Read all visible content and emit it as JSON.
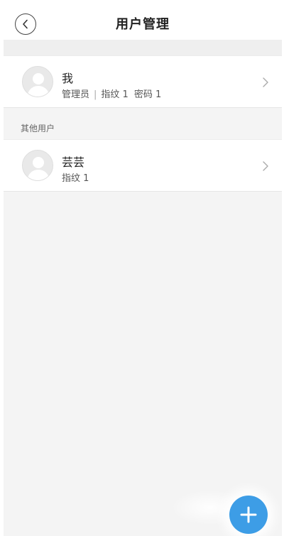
{
  "header": {
    "title": "用户管理",
    "back_icon": "chevron-left-icon"
  },
  "current_user": {
    "name": "我",
    "role": "管理员",
    "fingerprint": "指纹 1",
    "password": "密码 1"
  },
  "other_users": {
    "section_label": "其他用户",
    "items": [
      {
        "name": "芸芸",
        "fingerprint": "指纹 1"
      }
    ]
  },
  "fab": {
    "icon": "plus-icon",
    "color": "#3d9de6"
  },
  "colors": {
    "background": "#f4f4f4",
    "card": "#ffffff",
    "accent": "#3d9de6"
  }
}
